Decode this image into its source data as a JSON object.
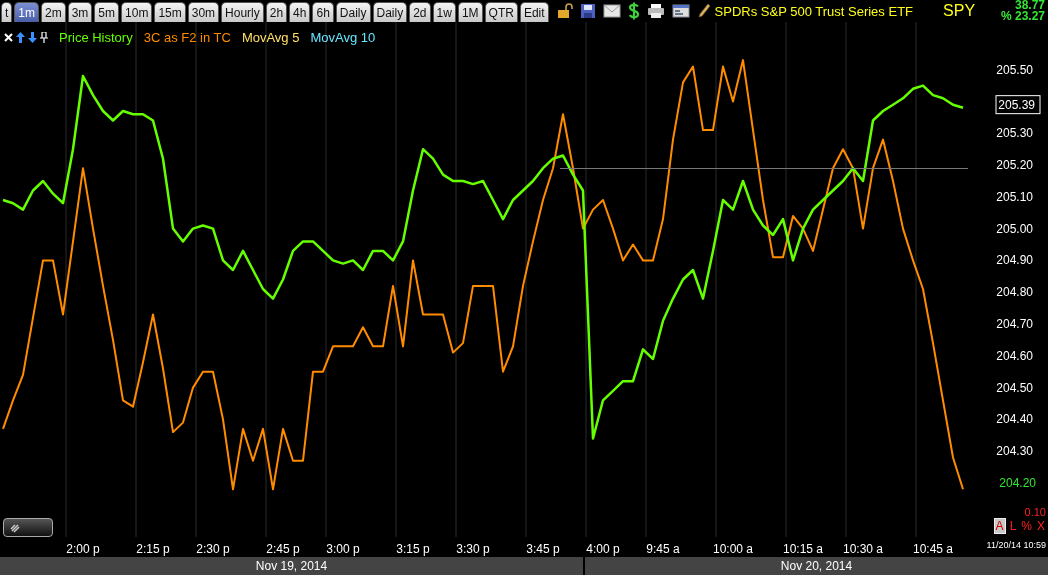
{
  "toolbar": {
    "tabs": [
      {
        "label": "t",
        "selected": false
      },
      {
        "label": "1m",
        "selected": true
      },
      {
        "label": "2m",
        "selected": false
      },
      {
        "label": "3m",
        "selected": false
      },
      {
        "label": "5m",
        "selected": false
      },
      {
        "label": "10m",
        "selected": false
      },
      {
        "label": "15m",
        "selected": false
      },
      {
        "label": "30m",
        "selected": false
      },
      {
        "label": "Hourly",
        "selected": false
      },
      {
        "label": "2h",
        "selected": false
      },
      {
        "label": "4h",
        "selected": false
      },
      {
        "label": "6h",
        "selected": false
      },
      {
        "label": "Daily",
        "selected": false
      },
      {
        "label": "Daily",
        "selected": false
      },
      {
        "label": "2d",
        "selected": false
      },
      {
        "label": "1w",
        "selected": false
      },
      {
        "label": "1M",
        "selected": false
      },
      {
        "label": "QTR",
        "selected": false
      },
      {
        "label": "Edit",
        "selected": false
      }
    ],
    "security_name": "SPDRs S&P 500 Trust Series ETF",
    "symbol": "SPY",
    "change": "38.77",
    "percent_change": "% 23.27"
  },
  "legend_extra": [
    {
      "label": "MovAvg 5",
      "color": "#ffe066"
    },
    {
      "label": "MovAvg 10",
      "color": "#66e6ff"
    }
  ],
  "chart": {
    "chart_data": {
      "type": "line",
      "ylim": [
        204.03,
        205.65
      ],
      "categories": [
        null,
        null,
        null,
        null,
        null,
        null,
        null,
        null,
        "2:00 p",
        null,
        null,
        null,
        null,
        null,
        null,
        "2:15 p",
        null,
        null,
        null,
        null,
        null,
        "2:30 p",
        null,
        null,
        null,
        null,
        null,
        null,
        "2:45 p",
        null,
        null,
        null,
        null,
        null,
        "3:00 p",
        null,
        null,
        null,
        null,
        null,
        null,
        "3:15 p",
        null,
        null,
        null,
        null,
        null,
        "3:30 p",
        null,
        null,
        null,
        null,
        null,
        null,
        "3:45 p",
        null,
        null,
        null,
        null,
        null,
        "4:00 p",
        null,
        null,
        null,
        null,
        null,
        "9:45 a",
        null,
        null,
        null,
        null,
        null,
        null,
        "10:00 a",
        null,
        null,
        null,
        null,
        null,
        null,
        "10:15 a",
        null,
        null,
        null,
        null,
        null,
        "10:30 a",
        null,
        null,
        null,
        null,
        null,
        null,
        "10:45 a",
        null,
        null,
        null
      ],
      "yticks": [
        {
          "value": 204.3,
          "label": "204.30"
        },
        {
          "value": 204.4,
          "label": "204.40"
        },
        {
          "value": 204.5,
          "label": "204.50"
        },
        {
          "value": 204.6,
          "label": "204.60"
        },
        {
          "value": 204.7,
          "label": "204.70"
        },
        {
          "value": 204.8,
          "label": "204.80"
        },
        {
          "value": 204.9,
          "label": "204.90"
        },
        {
          "value": 205.0,
          "label": "205.00"
        },
        {
          "value": 205.1,
          "label": "205.10"
        },
        {
          "value": 205.2,
          "label": "205.20"
        },
        {
          "value": 205.3,
          "label": "205.30"
        },
        {
          "value": 205.5,
          "label": "205.50"
        }
      ],
      "series": [
        {
          "name": "Price History",
          "color": "#66ff00",
          "values": [
            205.09,
            205.08,
            205.06,
            205.12,
            205.15,
            205.11,
            205.08,
            205.25,
            205.48,
            205.42,
            205.37,
            205.34,
            205.37,
            205.36,
            205.36,
            205.34,
            205.22,
            205.0,
            204.96,
            205.0,
            205.01,
            205.0,
            204.9,
            204.87,
            204.93,
            204.87,
            204.81,
            204.78,
            204.84,
            204.93,
            204.96,
            204.96,
            204.93,
            204.9,
            204.89,
            204.9,
            204.87,
            204.93,
            204.93,
            204.9,
            204.96,
            205.12,
            205.25,
            205.22,
            205.17,
            205.15,
            205.15,
            205.14,
            205.15,
            205.09,
            205.03,
            205.09,
            205.12,
            205.15,
            205.19,
            205.22,
            205.23,
            205.17,
            205.12,
            204.34,
            204.46,
            204.49,
            204.52,
            204.52,
            204.62,
            204.59,
            204.71,
            204.78,
            204.84,
            204.87,
            204.78,
            204.93,
            205.09,
            205.06,
            205.15,
            205.06,
            205.01,
            204.98,
            205.03,
            204.9,
            205.0,
            205.06,
            205.09,
            205.12,
            205.15,
            205.19,
            205.15,
            205.34,
            205.37,
            205.39,
            205.41,
            205.44,
            205.45,
            205.42,
            205.41,
            205.39,
            205.38
          ]
        },
        {
          "name": "3C as F2 in TC",
          "color": "#ff8c00",
          "values": [
            204.37,
            204.46,
            204.54,
            204.72,
            204.9,
            204.9,
            204.73,
            204.96,
            205.19,
            205.0,
            204.82,
            204.65,
            204.46,
            204.44,
            204.58,
            204.73,
            204.56,
            204.36,
            204.39,
            204.5,
            204.55,
            204.55,
            204.4,
            204.18,
            204.37,
            204.27,
            204.37,
            204.18,
            204.37,
            204.27,
            204.27,
            204.55,
            204.55,
            204.63,
            204.63,
            204.63,
            204.69,
            204.63,
            204.63,
            204.82,
            204.63,
            204.9,
            204.73,
            204.73,
            204.73,
            204.61,
            204.64,
            204.82,
            204.82,
            204.82,
            204.55,
            204.63,
            204.82,
            204.96,
            205.09,
            205.19,
            205.36,
            205.19,
            205.0,
            205.06,
            205.09,
            205.0,
            204.9,
            204.95,
            204.9,
            204.9,
            205.03,
            205.28,
            205.46,
            205.51,
            205.31,
            205.31,
            205.51,
            205.4,
            205.53,
            205.31,
            205.09,
            204.91,
            204.91,
            205.04,
            205.0,
            204.93,
            205.06,
            205.19,
            205.25,
            205.19,
            205.0,
            205.19,
            205.28,
            205.15,
            205.0,
            204.9,
            204.81,
            204.64,
            204.46,
            204.28,
            204.18
          ]
        }
      ]
    },
    "last_price": "205.39",
    "indicator_value": "204.20",
    "scale_value": "0.10",
    "scale_buttons": [
      {
        "label": "A",
        "selected": true
      },
      {
        "label": "L",
        "selected": false
      },
      {
        "label": "%",
        "selected": false
      },
      {
        "label": "X",
        "selected": false
      }
    ],
    "timestamp": "11/20/14 10:59"
  },
  "date_bar": [
    "Nov 19, 2014",
    "Nov 20, 2014"
  ]
}
